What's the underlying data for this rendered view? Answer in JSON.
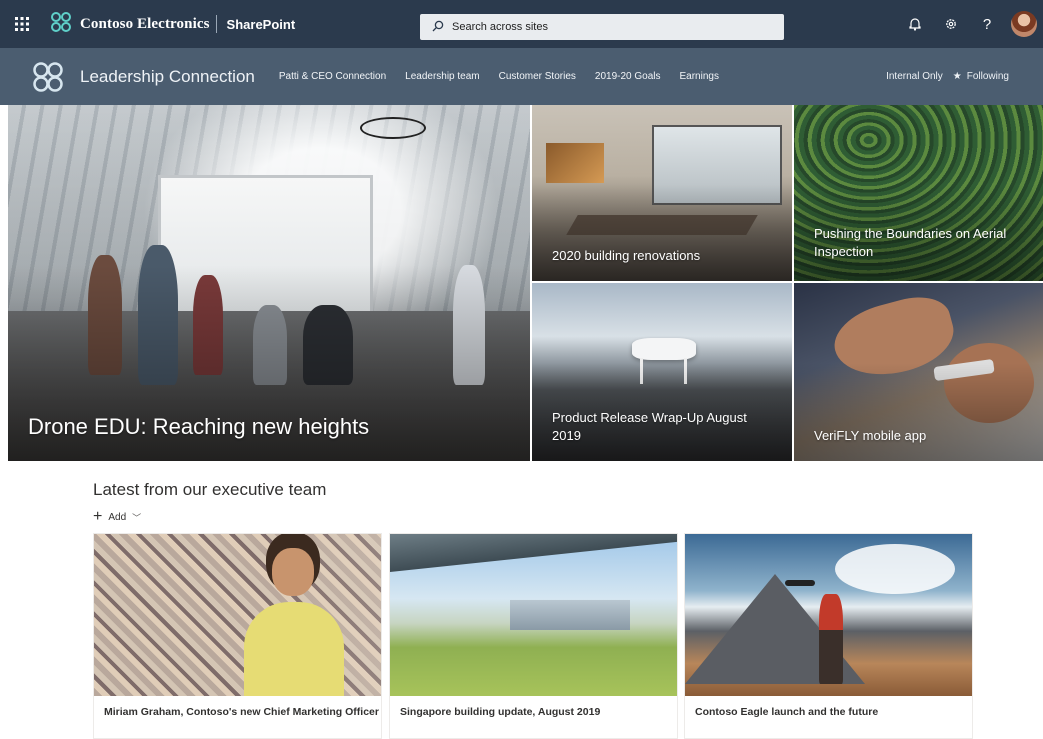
{
  "suite_bar": {
    "brand_name": "Contoso Electronics",
    "app_name": "SharePoint",
    "search_placeholder": "Search across sites",
    "icons": [
      "waffle-icon",
      "contoso-logo-icon",
      "search-icon",
      "bell-icon",
      "gear-icon",
      "help-icon",
      "avatar"
    ]
  },
  "site_header": {
    "title": "Leadership Connection",
    "nav": [
      "Patti & CEO Connection",
      "Leadership team",
      "Customer Stories",
      "2019-20 Goals",
      "Earnings"
    ],
    "internal_label": "Internal Only",
    "following_label": "Following"
  },
  "hero": {
    "tiles": [
      {
        "caption": "Drone EDU: Reaching new heights"
      },
      {
        "caption": "2020 building renovations"
      },
      {
        "caption": "Pushing the Boundaries on Aerial Inspection"
      },
      {
        "caption": "Product Release Wrap-Up August 2019"
      },
      {
        "caption": "VeriFLY mobile app"
      }
    ]
  },
  "news": {
    "title": "Latest from our executive team",
    "add_label": "Add",
    "cards": [
      {
        "title": "Miriam Graham, Contoso's new Chief Marketing Officer"
      },
      {
        "title": "Singapore building update, August 2019"
      },
      {
        "title": "Contoso Eagle launch and the future"
      }
    ]
  },
  "colors": {
    "suite_bar": "#2b3a4d",
    "site_header": "#4b5d70",
    "text_primary": "#323130"
  }
}
